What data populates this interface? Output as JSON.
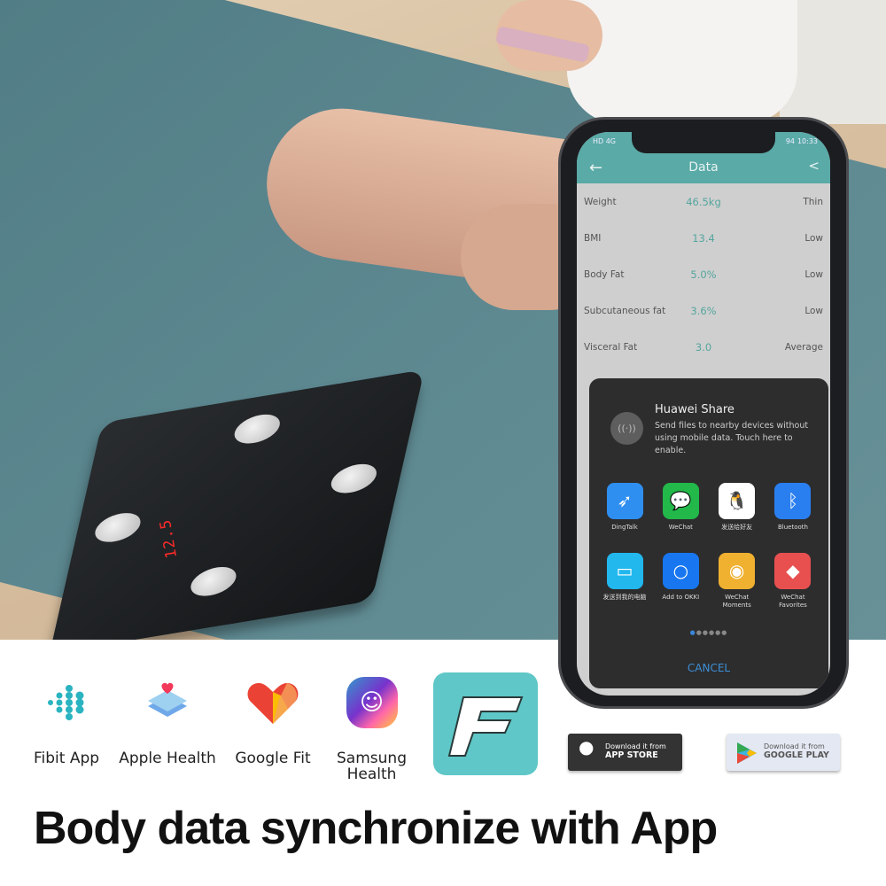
{
  "phone": {
    "status_time": "10:33",
    "battery": "94",
    "signal": "HD 4G",
    "app_title": "Data",
    "rows": [
      {
        "label": "Weight",
        "value": "46.5kg",
        "status": "Thin"
      },
      {
        "label": "BMI",
        "value": "13.4",
        "status": "Low"
      },
      {
        "label": "Body Fat",
        "value": "5.0%",
        "status": "Low"
      },
      {
        "label": "Subcutaneous fat",
        "value": "3.6%",
        "status": "Low"
      },
      {
        "label": "Visceral Fat",
        "value": "3.0",
        "status": "Average"
      }
    ],
    "share_dialog": {
      "title": "Huawei Share",
      "description": "Send files to nearby devices without using mobile data. Touch here to enable.",
      "apps": [
        {
          "label": "DingTalk",
          "icon": "dingtalk-icon",
          "color": "#2e8ff0"
        },
        {
          "label": "WeChat",
          "icon": "wechat-icon",
          "color": "#22b84a"
        },
        {
          "label": "发送给好友",
          "icon": "qq-penguin-icon",
          "color": "#ffffff"
        },
        {
          "label": "Bluetooth",
          "icon": "bluetooth-icon",
          "color": "#2a7ff0"
        },
        {
          "label": "发送到我的电脑",
          "icon": "computer-icon",
          "color": "#22b8ee"
        },
        {
          "label": "Add to OKKI",
          "icon": "okki-icon",
          "color": "#1877f0"
        },
        {
          "label": "WeChat Moments",
          "icon": "aperture-icon",
          "color": "#f0b030"
        },
        {
          "label": "WeChat Favorites",
          "icon": "cube-icon",
          "color": "#e85050"
        }
      ],
      "cancel": "CANCEL"
    }
  },
  "scale_display": "12.5",
  "brands": [
    {
      "label": "Fibit App",
      "icon": "fitbit-icon"
    },
    {
      "label": "Apple Health",
      "icon": "apple-health-icon"
    },
    {
      "label": "Google Fit",
      "icon": "google-fit-icon"
    },
    {
      "label": "Samsung Health",
      "icon": "samsung-health-icon"
    }
  ],
  "stores": {
    "apple": {
      "line1": "Download it from",
      "line2": "APP STORE"
    },
    "google": {
      "line1": "Download it from",
      "line2": "GOOGLE PLAY"
    }
  },
  "headline": "Body data synchronize with App"
}
